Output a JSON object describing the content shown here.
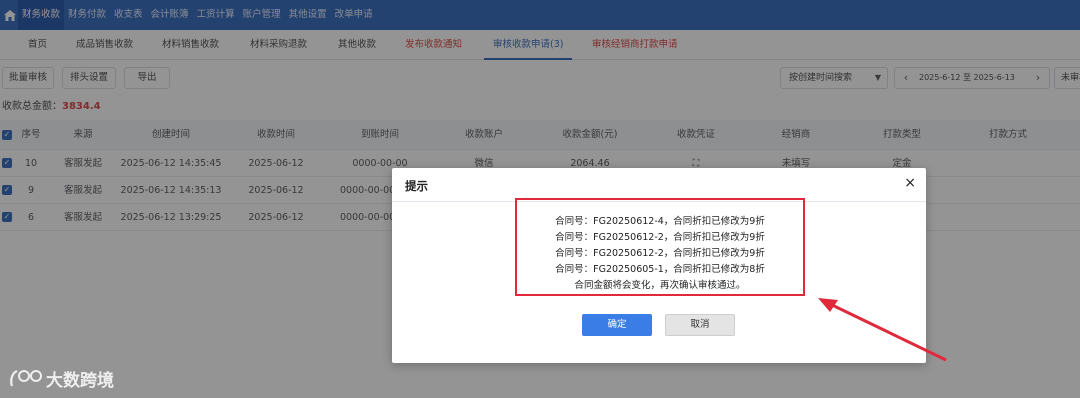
{
  "topnav": {
    "items": [
      "财务收款",
      "财务付款",
      "收支表",
      "会计账簿",
      "工资计算",
      "账户管理",
      "其他设置",
      "改单申请"
    ]
  },
  "subtabs": {
    "items": [
      "首页",
      "成品销售收款",
      "材料销售收款",
      "材料采购退款",
      "其他收款",
      "发布收款通知",
      "审核收款申请(3)",
      "审核经销商打款申请"
    ]
  },
  "toolbar": {
    "batch_review": "批量审核",
    "column_settings": "排头设置",
    "export": "导出",
    "search_mode": "按创建时间搜索",
    "date_range": "2025-6-12 至 2025-6-13",
    "extra": "未审核"
  },
  "summary": {
    "label": "收款总金额：",
    "value": "3834.4"
  },
  "table": {
    "headers": [
      "序号",
      "来源",
      "创建时间",
      "收款时间",
      "到账时间",
      "收款账户",
      "收款金额(元)",
      "收款凭证",
      "经销商",
      "打款类型",
      "打款方式"
    ],
    "rows": [
      [
        "10",
        "客服发起",
        "2025-06-12 14:35:45",
        "2025-06-12",
        "0000-00-00",
        "微信",
        "2064.46",
        "",
        "未填写",
        "定金",
        ""
      ],
      [
        "9",
        "客服发起",
        "2025-06-12 14:35:13",
        "2025-06-12",
        "0000-00-00",
        "",
        "",
        "",
        "",
        "",
        ""
      ],
      [
        "6",
        "客服发起",
        "2025-06-12 13:29:25",
        "2025-06-12",
        "0000-00-00",
        "",
        "",
        "",
        "",
        "",
        ""
      ]
    ]
  },
  "dialog": {
    "title": "提示",
    "close": "×",
    "lines": [
      "合同号：FG20250612-4，合同折扣已修改为9折",
      "合同号：FG20250612-2，合同折扣已修改为9折",
      "合同号：FG20250612-2，合同折扣已修改为9折",
      "合同号：FG20250605-1，合同折扣已修改为8折",
      "合同金额将会变化，再次确认审核通过。"
    ],
    "ok": "确定",
    "cancel": "取消"
  },
  "watermark": {
    "text": "大数跨境"
  },
  "colors": {
    "nav": "#3e73c2",
    "accent": "#3b7de6",
    "highlight": "#e0293a"
  }
}
